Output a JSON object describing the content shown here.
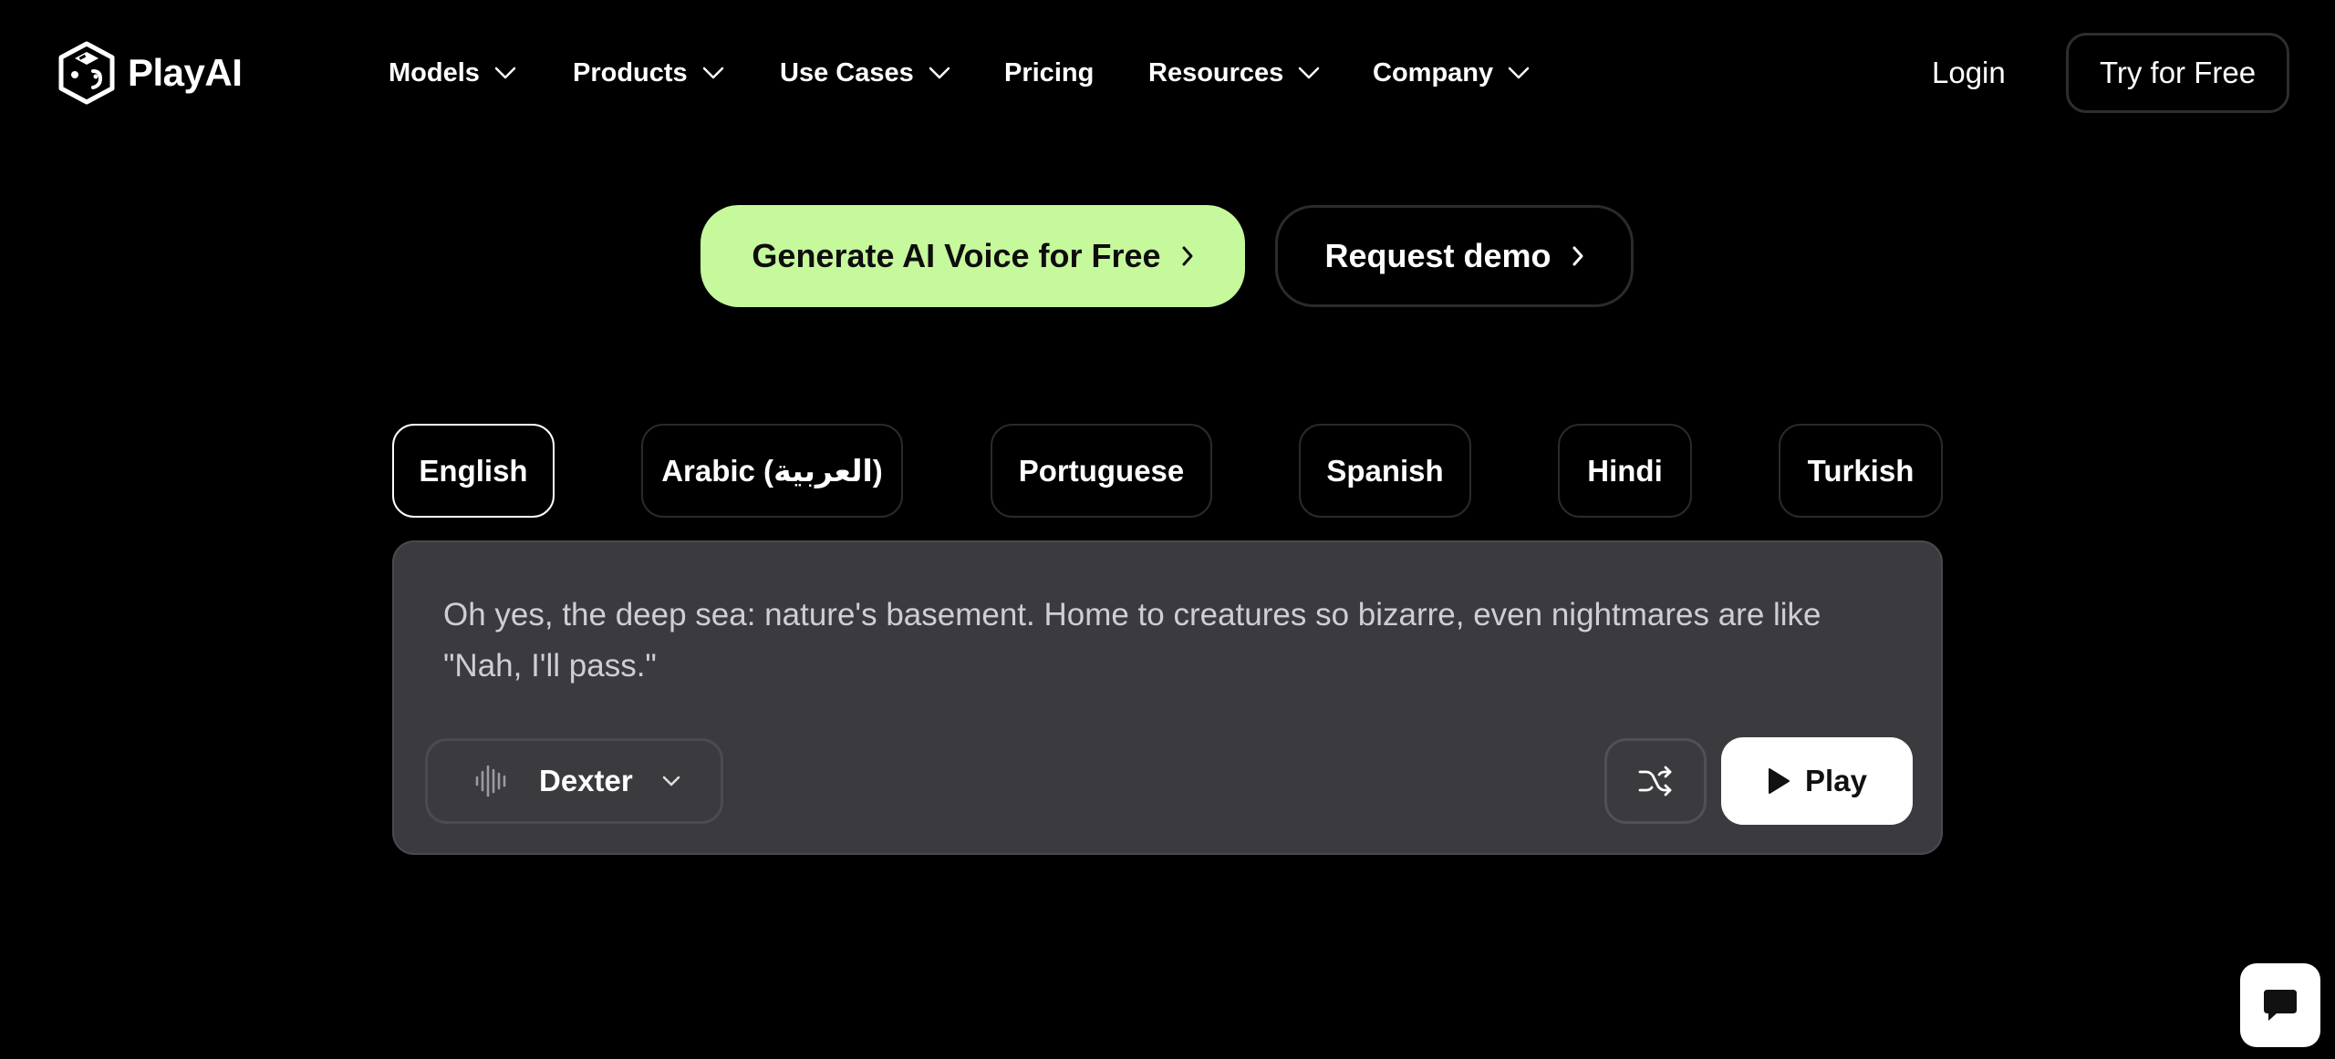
{
  "brand": {
    "name": "PlayAI"
  },
  "nav": {
    "items": [
      {
        "label": "Models",
        "has_dropdown": true
      },
      {
        "label": "Products",
        "has_dropdown": true
      },
      {
        "label": "Use Cases",
        "has_dropdown": true
      },
      {
        "label": "Pricing",
        "has_dropdown": false
      },
      {
        "label": "Resources",
        "has_dropdown": true
      },
      {
        "label": "Company",
        "has_dropdown": true
      }
    ],
    "login_label": "Login",
    "try_label": "Try for Free"
  },
  "cta": {
    "primary_label": "Generate AI Voice for Free",
    "secondary_label": "Request demo"
  },
  "languages": {
    "selected": "English",
    "tabs": [
      {
        "label": "English"
      },
      {
        "label": "Arabic (العربية)"
      },
      {
        "label": "Portuguese"
      },
      {
        "label": "Spanish"
      },
      {
        "label": "Hindi"
      },
      {
        "label": "Turkish"
      }
    ]
  },
  "demo": {
    "text": "Oh yes, the deep sea: nature's basement. Home to creatures so bizarre, even nightmares are like \"Nah, I'll pass.\"",
    "voice": "Dexter",
    "play_label": "Play",
    "icons": {
      "voice": "waveform-icon",
      "shuffle": "shuffle-icon",
      "play": "play-icon",
      "chat": "chat-bubble-icon"
    }
  },
  "colors": {
    "background": "#000000",
    "accent": "#c6f89c",
    "panel": "#3b3b3f"
  }
}
